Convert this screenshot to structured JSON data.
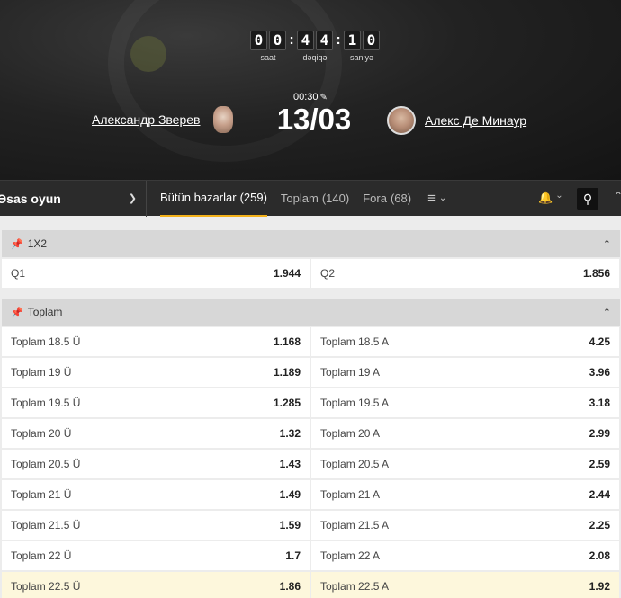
{
  "header": {
    "timer": {
      "hours": [
        "0",
        "0"
      ],
      "minutes": [
        "4",
        "4"
      ],
      "seconds": [
        "1",
        "0"
      ],
      "hours_label": "saat",
      "minutes_label": "dəqiqə",
      "seconds_label": "saniyə"
    },
    "game_time": "00:30",
    "score": "13/03",
    "player1": "Александр Зверев",
    "player2": "Алекс Де Минаур"
  },
  "nav": {
    "dropdown_label": "Əsas oyun",
    "tabs": [
      {
        "label": "Bütün bazarlar",
        "count": "(259)",
        "active": true
      },
      {
        "label": "Toplam",
        "count": "(140)",
        "active": false
      },
      {
        "label": "Fora",
        "count": "(68)",
        "active": false
      }
    ]
  },
  "sections": {
    "x12": {
      "title": "1X2",
      "rows": [
        {
          "l_label": "Q1",
          "l_odd": "1.944",
          "r_label": "Q2",
          "r_odd": "1.856"
        }
      ]
    },
    "total": {
      "title": "Toplam",
      "rows": [
        {
          "l_label": "Toplam 18.5 Ü",
          "l_odd": "1.168",
          "r_label": "Toplam 18.5 A",
          "r_odd": "4.25"
        },
        {
          "l_label": "Toplam 19 Ü",
          "l_odd": "1.189",
          "r_label": "Toplam 19 A",
          "r_odd": "3.96"
        },
        {
          "l_label": "Toplam 19.5 Ü",
          "l_odd": "1.285",
          "r_label": "Toplam 19.5 A",
          "r_odd": "3.18"
        },
        {
          "l_label": "Toplam 20 Ü",
          "l_odd": "1.32",
          "r_label": "Toplam 20 A",
          "r_odd": "2.99"
        },
        {
          "l_label": "Toplam 20.5 Ü",
          "l_odd": "1.43",
          "r_label": "Toplam 20.5 A",
          "r_odd": "2.59"
        },
        {
          "l_label": "Toplam 21 Ü",
          "l_odd": "1.49",
          "r_label": "Toplam 21 A",
          "r_odd": "2.44"
        },
        {
          "l_label": "Toplam 21.5 Ü",
          "l_odd": "1.59",
          "r_label": "Toplam 21.5 A",
          "r_odd": "2.25"
        },
        {
          "l_label": "Toplam 22 Ü",
          "l_odd": "1.7",
          "r_label": "Toplam 22 A",
          "r_odd": "2.08"
        },
        {
          "l_label": "Toplam 22.5 Ü",
          "l_odd": "1.86",
          "r_label": "Toplam 22.5 A",
          "r_odd": "1.92"
        }
      ]
    }
  },
  "colors": {
    "accent": "#f3b11a",
    "highlight_row": "#fdf7dc",
    "nav_bg": "#2b2b2b"
  },
  "icons": {
    "serve": "tennis-serve-icon",
    "pin": "pin-icon",
    "chevron_up": "chevron-up-icon",
    "chevron_down": "chevron-down-icon",
    "menu": "list-menu-icon",
    "bell": "bell-icon",
    "search": "search-icon"
  }
}
